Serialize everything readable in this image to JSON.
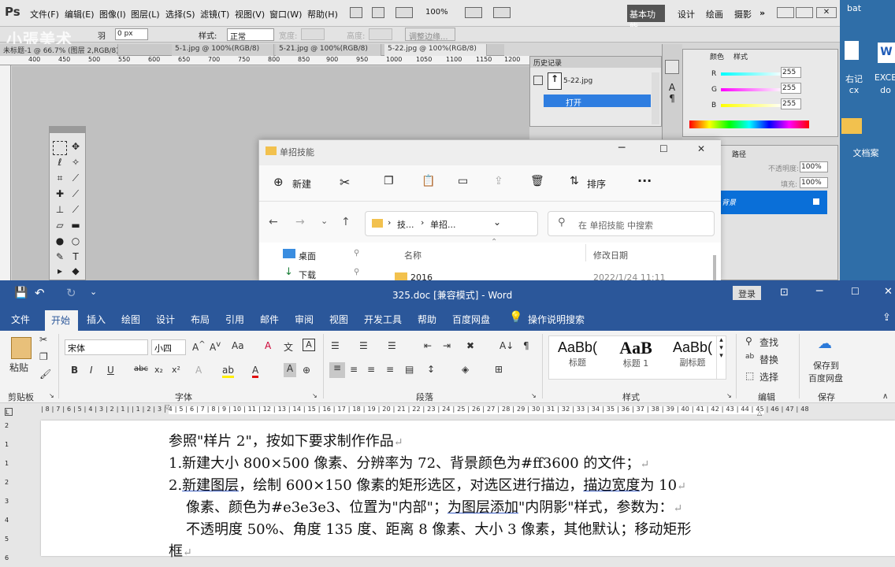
{
  "desktop": {
    "icon1": "EXCE",
    "icon1_sub": "do",
    "icon2": "bat",
    "icon3": "右记",
    "icon3_sub": "cx",
    "icon4": "文档案"
  },
  "ps": {
    "logo": "Ps",
    "menu": [
      "文件(F)",
      "编辑(E)",
      "图像(I)",
      "图层(L)",
      "选择(S)",
      "滤镜(T)",
      "视图(V)",
      "窗口(W)",
      "帮助(H)"
    ],
    "zoom": "100%",
    "workspaces": [
      "基本功能",
      "设计",
      "绘画",
      "摄影"
    ],
    "watermark": "小張美术",
    "options": {
      "feather_value": "0 px",
      "style_label": "样式:",
      "style_value": "正常",
      "width_label": "宽度:",
      "height_label": "高度:",
      "refine_button": "调整边缘..."
    },
    "tabs": [
      "未标题-1 @ 66.7% (图层 2,RGB/8)",
      "5-1.jpg @ 100%(RGB/8)",
      "5-21.jpg @ 100%(RGB/8)",
      "5-22.jpg @ 100%(RGB/8)"
    ],
    "ruler_marks": [
      "400",
      "450",
      "500",
      "550",
      "600",
      "650",
      "700",
      "750",
      "800",
      "850",
      "900",
      "950",
      "1000",
      "1050",
      "1100",
      "1150",
      "1200"
    ],
    "history": {
      "title": "历史记录",
      "snapshot": "5-22.jpg",
      "step": "打开"
    },
    "color": {
      "tabs": [
        "颜色",
        "样式"
      ],
      "r_label": "R",
      "g_label": "G",
      "b_label": "B",
      "r": "255",
      "g": "255",
      "b": "255"
    },
    "layers": {
      "opacity_label": "不透明度:",
      "opacity": "100%",
      "fill_label": "填充:",
      "fill": "100%",
      "tab": "路径",
      "layer_name": "背景"
    }
  },
  "explorer": {
    "title": "单招技能",
    "new_button": "新建",
    "sort_button": "排序",
    "address": [
      "技...",
      "单招..."
    ],
    "search_placeholder": "在 单招技能 中搜索",
    "nav": [
      "桌面",
      "下载"
    ],
    "col_name": "名称",
    "col_date": "修改日期",
    "row": {
      "name": "2016",
      "date": "2022/1/24 11:11"
    }
  },
  "word": {
    "title": "325.doc [兼容模式] - Word",
    "login_button": "登录",
    "tabs": [
      "文件",
      "开始",
      "插入",
      "绘图",
      "设计",
      "布局",
      "引用",
      "邮件",
      "审阅",
      "视图",
      "开发工具",
      "帮助",
      "百度网盘"
    ],
    "tell_me": "操作说明搜索",
    "clipboard": {
      "paste": "粘贴",
      "group": "剪贴板"
    },
    "font": {
      "name": "宋体",
      "size": "小四",
      "group": "字体"
    },
    "paragraph_group": "段落",
    "styles": {
      "group": "样式",
      "items": [
        {
          "sample": "AaBb(",
          "name": "标题"
        },
        {
          "sample": "AaB",
          "name": "标题 1"
        },
        {
          "sample": "AaBb(",
          "name": "副标题"
        }
      ]
    },
    "editing": {
      "find": "查找",
      "replace": "替换",
      "select": "选择",
      "group": "编辑"
    },
    "save": {
      "label1": "保存到",
      "label2": "百度网盘",
      "group": "保存"
    },
    "hruler": "| 8 | 7 | 6 | 5 | 4 | 3 | 2 | 1 |  | 1 | 2 | 3 | 4 | 5 | 6 | 7 | 8 | 9 | 10 | 11 | 12 | 13 | 14 | 15 | 16 | 17 | 18 | 19 | 20 | 21 | 22 | 23 | 24 | 25 | 26 | 27 | 28 | 29 | 30 | 31 | 32 | 33 | 34 | 35 | 36 | 37 | 38 | 39 | 40 | 41 | 42 | 43 | 44 | 45 | 46 | 47 | 48",
    "vruler": [
      "2",
      "1",
      "1",
      "2",
      "3",
      "4",
      "5",
      "6"
    ],
    "doc": {
      "line1": "参照\"样片 2\"，按如下要求制作作品",
      "line2": "1.新建大小 800×500 像素、分辨率为 72、背景颜色为#ff3600 的文件；",
      "line3_num": "2.",
      "line3_a": "新建图层",
      "line3_b": "，绘制 600×150 像素的矩形选区，对选区进行描边，",
      "line3_c": "描边宽度",
      "line3_d": "为 10",
      "line4_a": "像素、颜色为#e3e3e3、位置为\"内部\"；",
      "line4_b": "为图层添加",
      "line4_c": "\"内阴影\"样式，参数为：",
      "line5": "不透明度 50%、角度 135 度、距离 8 像素、大小 3 像素，其他默认；移动矩形",
      "line6": "框"
    }
  }
}
